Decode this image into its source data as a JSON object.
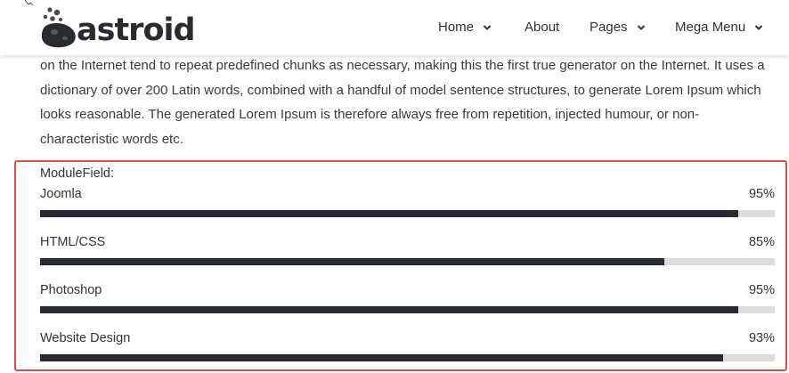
{
  "header": {
    "brand": "astroid",
    "nav": [
      {
        "label": "Home",
        "has_dropdown": true
      },
      {
        "label": "About",
        "has_dropdown": false
      },
      {
        "label": "Pages",
        "has_dropdown": true
      },
      {
        "label": "Mega Menu",
        "has_dropdown": true
      }
    ]
  },
  "content": {
    "paragraph_lines": [
      "on the Internet tend to repeat predefined chunks as necessary, making this the first true generator on the Internet. It uses a",
      "dictionary of over 200 Latin words, combined with a handful of model sentence structures, to generate Lorem Ipsum which",
      "looks reasonable. The generated Lorem Ipsum is therefore always free from repetition, injected humour, or non-",
      "characteristic words etc."
    ]
  },
  "module": {
    "title": "ModuleField:",
    "skills": [
      {
        "label": "Joomla",
        "percent_text": "95%",
        "value": 95
      },
      {
        "label": "HTML/CSS",
        "percent_text": "85%",
        "value": 85
      },
      {
        "label": "Photoshop",
        "percent_text": "95%",
        "value": 95
      },
      {
        "label": "Website Design",
        "percent_text": "93%",
        "value": 93
      }
    ]
  },
  "colors": {
    "bar_fill": "#272a31",
    "bar_track": "#dcdcdc",
    "highlight_border": "#e34a4a"
  }
}
